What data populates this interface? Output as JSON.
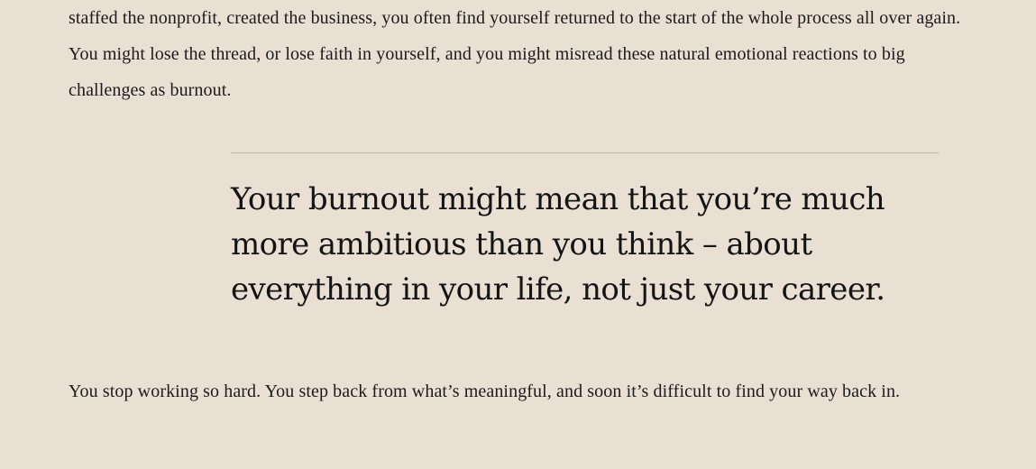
{
  "article": {
    "paragraph_top": "staffed the nonprofit, created the business, you often find yourself returned to the start of the whole process all over again. You might lose the thread, or lose faith in yourself, and you might misread these natural emotional reactions to big challenges as burnout.",
    "pull_quote": "Your burnout might mean that you’re much more ambitious than you think – about everything in your life, not just your career.",
    "paragraph_bottom": "You stop working so hard. You step back from what’s meaningful, and soon it’s difficult to find your way back in."
  },
  "colors": {
    "background": "#e9e0d3",
    "text": "#1b1b1b",
    "rule": "#bcb3a7"
  }
}
